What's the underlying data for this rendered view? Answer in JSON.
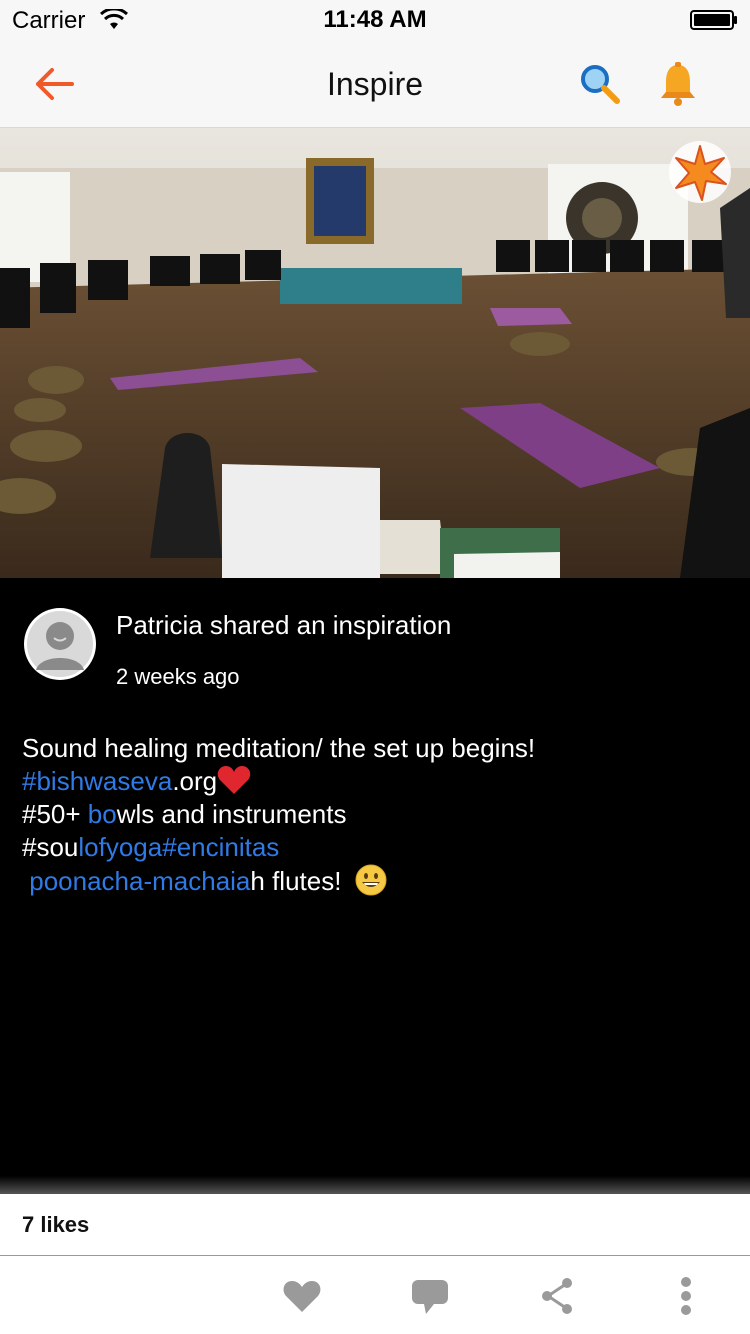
{
  "status_bar": {
    "carrier": "Carrier",
    "time": "11:48 AM"
  },
  "nav": {
    "title": "Inspire"
  },
  "post": {
    "header": "Patricia shared an inspiration",
    "time": "2 weeks ago",
    "line1": "Sound healing meditation/ the set up begins!",
    "line2_tag": "#bishwaseva",
    "line2_rest": ".org",
    "line3_a": "#50+ ",
    "line3_tag": "bo",
    "line3_rest": "wls and instruments",
    "line4_a": "#sou",
    "line4_tag": "lofyoga#encinitas",
    "line5_tag": "poonacha-machaia",
    "line5_rest": "h  flutes! "
  },
  "likes": {
    "count_label": "7 likes"
  },
  "colors": {
    "accent": "#f05a28",
    "link": "#2f7ae5",
    "bell": "#f5a623"
  },
  "icons": {
    "back": "arrow-left-icon",
    "search": "search-icon",
    "bell": "bell-icon",
    "badge": "star-burst-icon",
    "like": "heart-icon",
    "comment": "comment-icon",
    "share": "share-icon",
    "more": "more-vertical-icon"
  }
}
